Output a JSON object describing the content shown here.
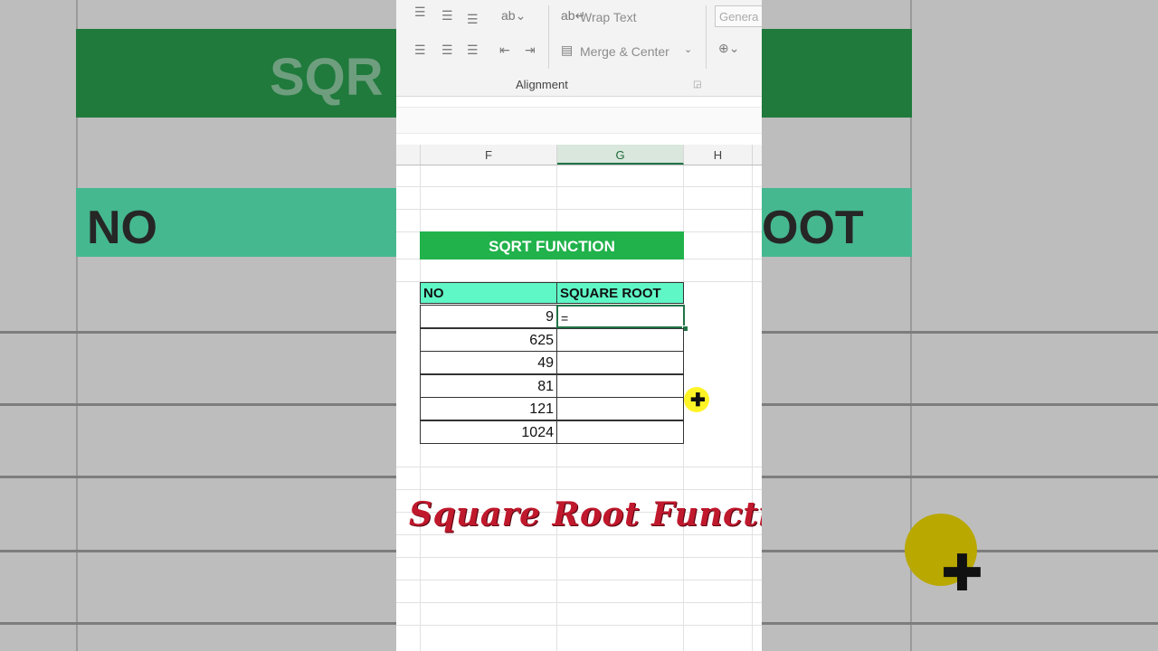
{
  "ribbon": {
    "wrap_text_label": "Wrap Text",
    "merge_center_label": "Merge & Center",
    "alignment_group_label": "Alignment",
    "number_format_value": "Genera"
  },
  "columns": [
    {
      "label": "F",
      "selected": false
    },
    {
      "label": "G",
      "selected": true
    },
    {
      "label": "H",
      "selected": false
    }
  ],
  "sheet": {
    "title": "SQRT FUNCTION",
    "headers": {
      "no": "NO",
      "result": "SQUARE ROOT"
    },
    "rows": [
      {
        "no": "9",
        "result": "="
      },
      {
        "no": "625",
        "result": ""
      },
      {
        "no": "49",
        "result": ""
      },
      {
        "no": "81",
        "result": ""
      },
      {
        "no": "121",
        "result": ""
      },
      {
        "no": "1024",
        "result": ""
      }
    ]
  },
  "background": {
    "title_fragment": "SQR",
    "header_left": "NO",
    "header_right": "OOT"
  },
  "caption": "Square Root Function",
  "colors": {
    "excel_green": "#217346",
    "title_fill": "#21b24b",
    "header_fill": "#5ff7c6",
    "caption": "#c0182c"
  }
}
